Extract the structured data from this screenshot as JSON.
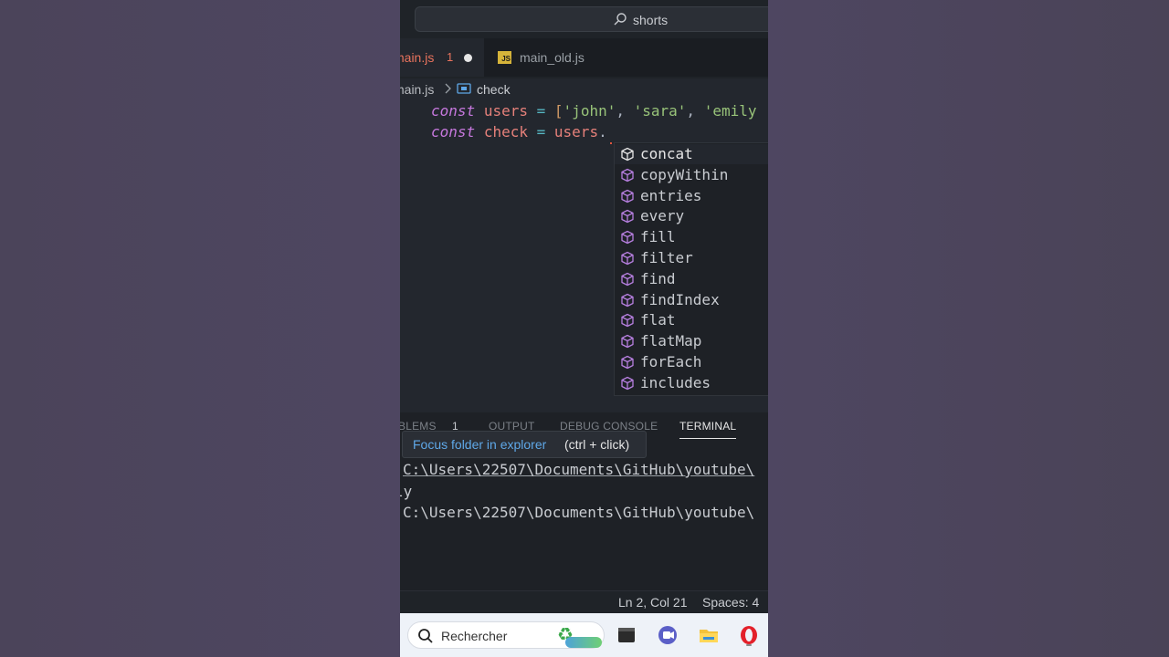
{
  "command_center": {
    "label": "shorts"
  },
  "tabs": [
    {
      "name": "main.js",
      "problems": "1"
    },
    {
      "name": "main_old.js"
    }
  ],
  "breadcrumb": {
    "file": "main.js",
    "symbol": "check"
  },
  "editor": {
    "line1": {
      "kw": "const",
      "var": "users",
      "op": "=",
      "open": "[",
      "s1": "'john'",
      "c1": ",",
      "s2": "'sara'",
      "c2": ",",
      "s3": "'emily"
    },
    "line2": {
      "kw": "const",
      "var": "check",
      "op": "=",
      "obj": "users",
      "dot": "."
    }
  },
  "suggestions": [
    "concat",
    "copyWithin",
    "entries",
    "every",
    "fill",
    "filter",
    "find",
    "findIndex",
    "flat",
    "flatMap",
    "forEach",
    "includes"
  ],
  "panel": {
    "tabs": [
      "BLEMS",
      "1",
      "OUTPUT",
      "DEBUG CONSOLE",
      "TERMINAL"
    ],
    "tooltip": {
      "link": "Focus folder in explorer",
      "hint": "(ctrl + click)"
    },
    "terminal_lines": [
      "C:\\Users\\22507\\Documents\\GitHub\\youtube\\",
      "ly",
      "C:\\Users\\22507\\Documents\\GitHub\\youtube\\"
    ]
  },
  "status": {
    "position": "Ln 2, Col 21",
    "spaces": "Spaces: 4"
  },
  "taskbar": {
    "search_label": "Rechercher"
  },
  "colors": {
    "accent_error": "#e8735d",
    "keyword": "#c678dd",
    "variable": "#e5807a",
    "string": "#98c379",
    "link": "#5fa8e8"
  }
}
